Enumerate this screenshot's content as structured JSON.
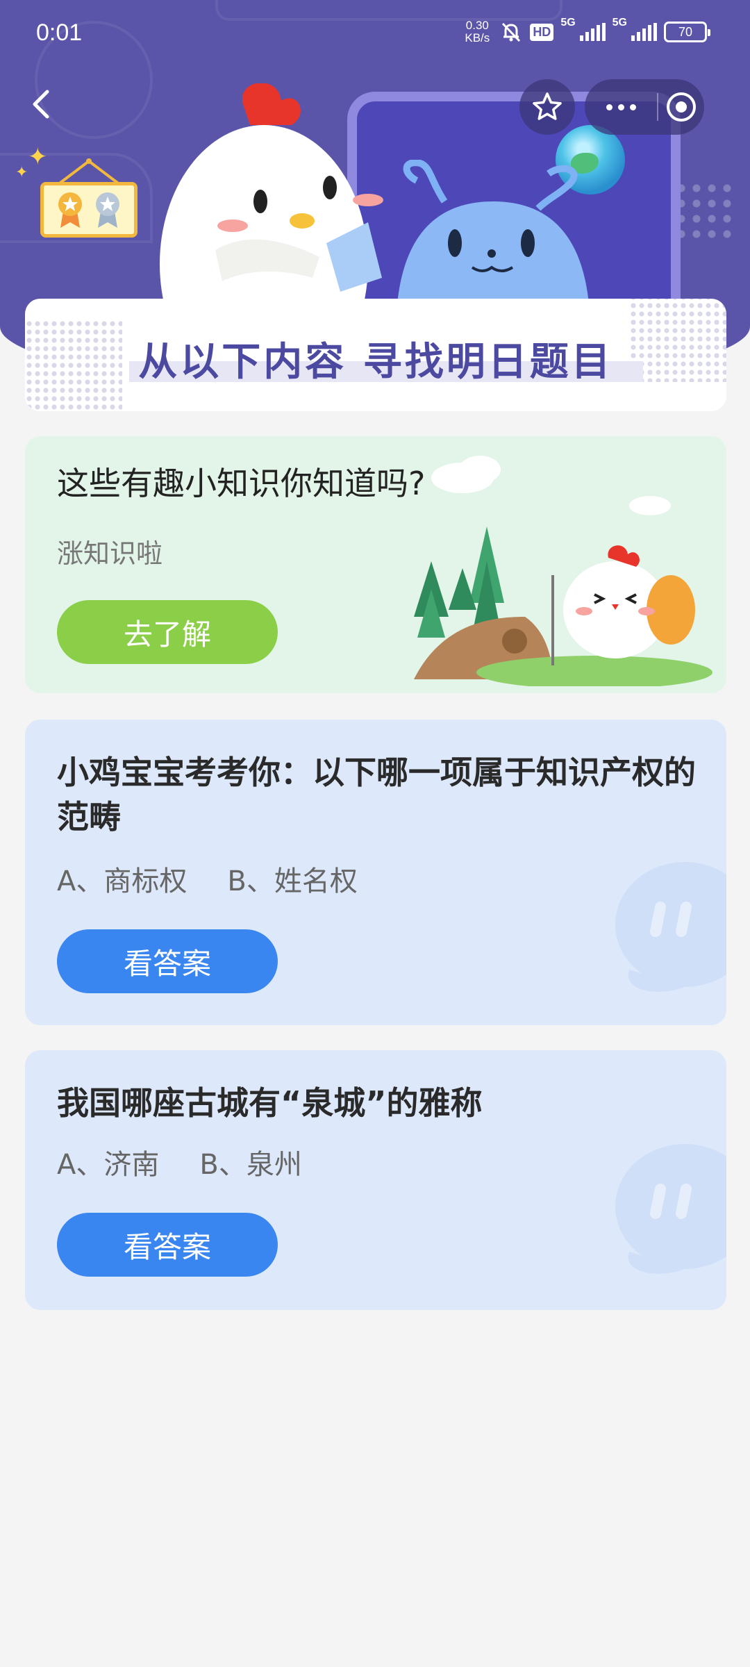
{
  "status_bar": {
    "time": "0:01",
    "net_speed_value": "0.30",
    "net_speed_unit": "KB/s",
    "hd_label": "HD",
    "sim1_label": "5G",
    "sim2_label": "5G",
    "battery": "70"
  },
  "header": {
    "banner_title": "从以下内容  寻找明日题目"
  },
  "knowledge_card": {
    "title": "这些有趣小知识你知道吗?",
    "subtitle": "涨知识啦",
    "button_label": "去了解"
  },
  "questions": [
    {
      "title": "小鸡宝宝考考你：以下哪一项属于知识产权的范畴",
      "option_a": "A、商标权",
      "option_b": "B、姓名权",
      "button_label": "看答案"
    },
    {
      "title": "我国哪座古城有“泉城”的雅称",
      "option_a": "A、济南",
      "option_b": "B、泉州",
      "button_label": "看答案"
    }
  ],
  "colors": {
    "header_bg": "#5a55a8",
    "green_card": "#e2f5e8",
    "blue_card": "#dde9fb",
    "green_button": "#8bcf48",
    "blue_button": "#3a86f0"
  }
}
